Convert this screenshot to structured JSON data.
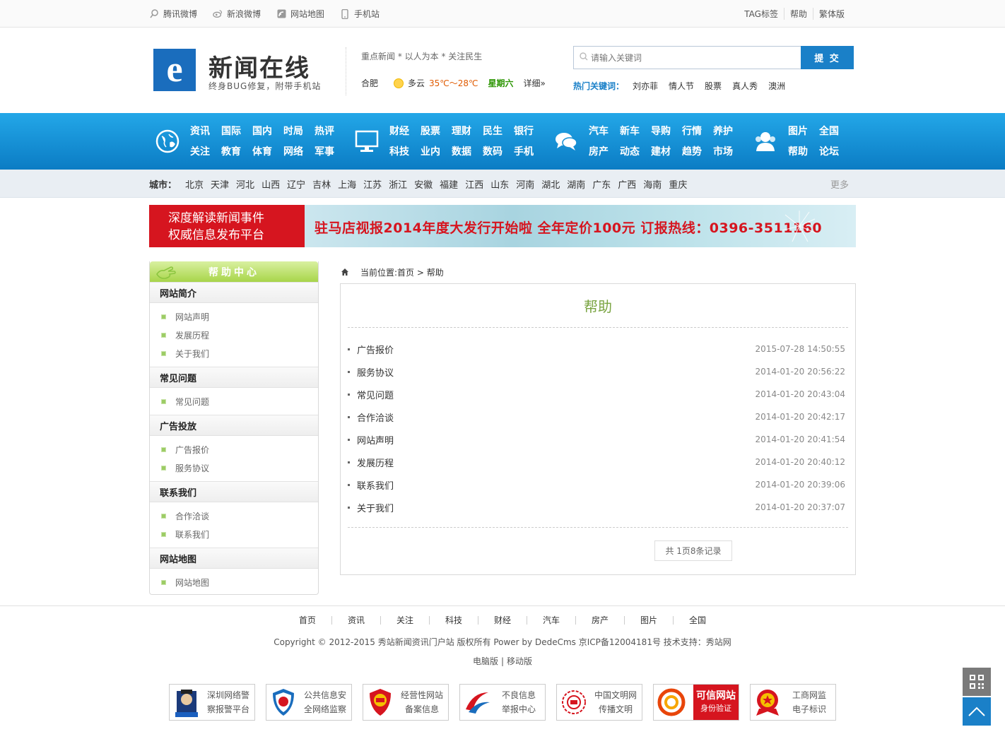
{
  "topbar": {
    "left": [
      {
        "icon": "tencent-weibo-icon",
        "label": "腾讯微博"
      },
      {
        "icon": "sina-weibo-icon",
        "label": "新浪微博"
      },
      {
        "icon": "sitemap-icon",
        "label": "网站地图"
      },
      {
        "icon": "mobile-icon",
        "label": "手机站"
      }
    ],
    "right": [
      "TAG标签",
      "帮助",
      "繁体版"
    ]
  },
  "header": {
    "logo_letter": "e",
    "site_name": "新闻在线",
    "site_sub": "终身BUG修复，附带手机站",
    "slogan": "重点新闻 * 以人为本 * 关注民生",
    "weather": {
      "city": "合肥",
      "cond": "多云",
      "temp": "35℃～28℃",
      "weekday": "星期六",
      "more": "详细»"
    },
    "search": {
      "placeholder": "请输入关键词",
      "button": "提 交"
    },
    "hot": {
      "label": "热门关键词：",
      "items": [
        "刘亦菲",
        "情人节",
        "股票",
        "真人秀",
        "澳洲"
      ]
    }
  },
  "nav": {
    "groups": [
      {
        "icon": "globe-icon",
        "items": [
          "资讯",
          "国际",
          "国内",
          "时局",
          "热评",
          "关注",
          "教育",
          "体育",
          "网络",
          "军事"
        ]
      },
      {
        "icon": "monitor-icon",
        "items": [
          "财经",
          "股票",
          "理财",
          "民生",
          "银行",
          "科技",
          "业内",
          "数据",
          "数码",
          "手机"
        ]
      },
      {
        "icon": "chat-icon",
        "items": [
          "汽车",
          "新车",
          "导购",
          "行情",
          "养护",
          "房产",
          "动态",
          "建材",
          "趋势",
          "市场"
        ]
      },
      {
        "icon": "users-icon",
        "items": [
          "图片",
          "全国",
          "帮助",
          "论坛"
        ]
      }
    ]
  },
  "cities": {
    "label": "城市：",
    "items": [
      "北京",
      "天津",
      "河北",
      "山西",
      "辽宁",
      "吉林",
      "上海",
      "江苏",
      "浙江",
      "安徽",
      "福建",
      "江西",
      "山东",
      "河南",
      "湖北",
      "湖南",
      "广东",
      "广西",
      "海南",
      "重庆"
    ],
    "more": "更多"
  },
  "banner": {
    "left_lines": [
      "深度解读新闻事件",
      "权威信息发布平台"
    ],
    "text": "驻马店视报2014年度大发行开始啦  全年定价100元  订报热线：0396-3511160"
  },
  "sidebar": {
    "title": "帮助中心",
    "sections": [
      {
        "title": "网站简介",
        "items": [
          "网站声明",
          "发展历程",
          "关于我们"
        ]
      },
      {
        "title": "常见问题",
        "items": [
          "常见问题"
        ]
      },
      {
        "title": "广告投放",
        "items": [
          "广告报价",
          "服务协议"
        ]
      },
      {
        "title": "联系我们",
        "items": [
          "合作洽谈",
          "联系我们"
        ]
      },
      {
        "title": "网站地图",
        "items": [
          "网站地图"
        ]
      }
    ]
  },
  "content": {
    "crumb": "当前位置:首页 > 帮助",
    "title": "帮助",
    "list": [
      {
        "title": "广告报价",
        "date": "2015-07-28 14:50:55"
      },
      {
        "title": "服务协议",
        "date": "2014-01-20 20:56:22"
      },
      {
        "title": "常见问题",
        "date": "2014-01-20 20:43:04"
      },
      {
        "title": "合作洽谈",
        "date": "2014-01-20 20:42:17"
      },
      {
        "title": "网站声明",
        "date": "2014-01-20 20:41:54"
      },
      {
        "title": "发展历程",
        "date": "2014-01-20 20:40:12"
      },
      {
        "title": "联系我们",
        "date": "2014-01-20 20:39:06"
      },
      {
        "title": "关于我们",
        "date": "2014-01-20 20:37:07"
      }
    ],
    "pager": "共 1页8条记录"
  },
  "footer": {
    "links": [
      "首页",
      "资讯",
      "关注",
      "科技",
      "财经",
      "汽车",
      "房产",
      "图片",
      "全国"
    ],
    "copyright": "Copyright © 2012-2015 秀站新闻资讯门户站 版权所有 Power by DedeCms 京ICP备12004181号  技术支持：秀站网",
    "versions": [
      "电脑版",
      "移动版"
    ],
    "badges": [
      {
        "icon": "police-icon",
        "line1": "深圳网络警",
        "line2": "察报警平台"
      },
      {
        "icon": "shield-icon",
        "line1": "公共信息安",
        "line2": "全网络监察"
      },
      {
        "icon": "emblem-icon",
        "line1": "经营性网站",
        "line2": "备案信息"
      },
      {
        "icon": "swoosh-icon",
        "line1": "不良信息",
        "line2": "举报中心"
      },
      {
        "icon": "civilization-icon",
        "line1": "中国文明网",
        "line2": "传播文明"
      },
      {
        "icon": "trust-icon",
        "line1": "可信网站",
        "line2": "身份验证"
      },
      {
        "icon": "badge-icon",
        "line1": "工商网监",
        "line2": "电子标识"
      }
    ]
  },
  "colors": {
    "accent": "#1a80c8",
    "nav_top": "#23a7e8",
    "nav_bottom": "#0b7cc4",
    "green": "#7aa442",
    "red": "#d6151f"
  }
}
